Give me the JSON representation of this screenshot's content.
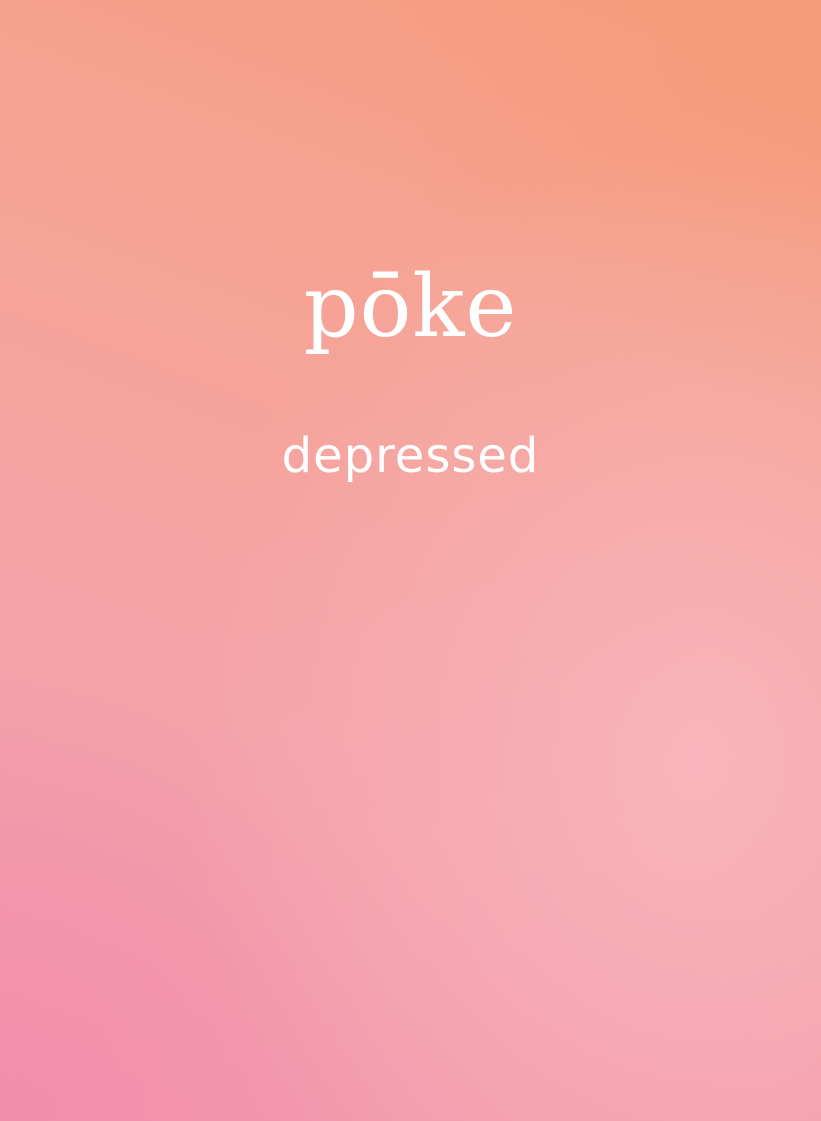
{
  "card": {
    "word": "pōke",
    "translation": "depressed"
  },
  "colors": {
    "gradient_top_right": "#F59C7C",
    "gradient_mid": "#F6A394",
    "gradient_bottom_left": "#F395AF",
    "glow_pink": "#F8B8BE",
    "text": "#FFFFFF"
  }
}
